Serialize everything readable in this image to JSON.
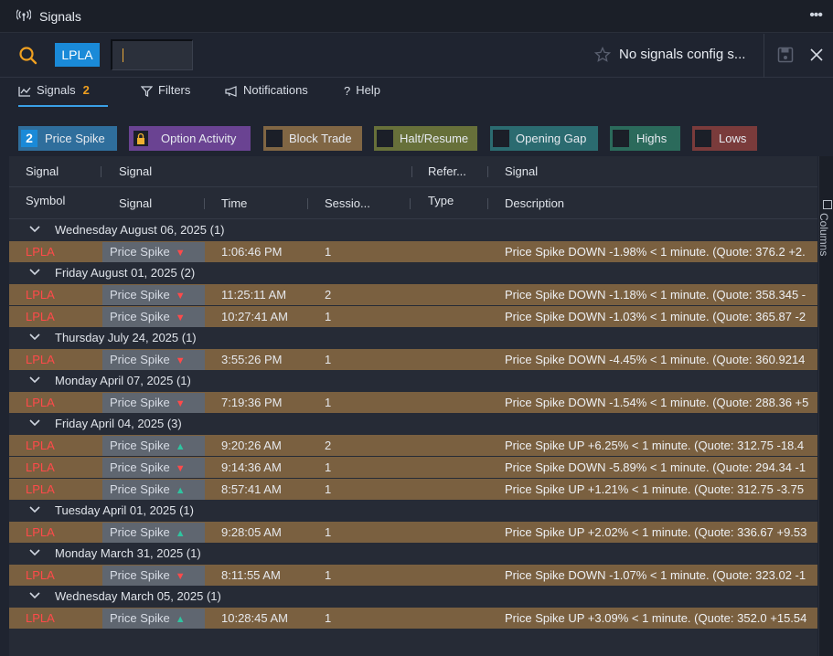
{
  "window": {
    "title": "Signals",
    "menu_icon": "ellipsis-icon"
  },
  "toolbar": {
    "symbol_tag": "LPLA",
    "symbol_input_value": "",
    "config_label": "No signals config s...",
    "icons": [
      "search-icon",
      "star-icon",
      "save-icon",
      "close-icon"
    ]
  },
  "tabs": [
    {
      "label": "Signals",
      "badge": "2",
      "icon": "chart-line-icon",
      "active": true
    },
    {
      "label": "Filters",
      "icon": "filter-icon"
    },
    {
      "label": "Notifications",
      "icon": "megaphone-icon"
    },
    {
      "label": "Help",
      "icon": "question-icon"
    }
  ],
  "chips": {
    "price_spike": {
      "label": "Price Spike",
      "count": "2"
    },
    "option_activity": {
      "label": "Option Activity"
    },
    "block_trade": {
      "label": "Block Trade"
    },
    "halt_resume": {
      "label": "Halt/Resume"
    },
    "opening_gap": {
      "label": "Opening Gap"
    },
    "highs": {
      "label": "Highs"
    },
    "lows": {
      "label": "Lows"
    }
  },
  "colors": {
    "accent_blue": "#1a8ad8",
    "row_bg": "#7a6040",
    "symbol_red": "#ff4a4a",
    "up_green": "#2fc4a0",
    "badge_orange": "#f0a020"
  },
  "grid": {
    "group_headers": {
      "signal": "Signal",
      "signal2": "Signal",
      "reference": "Refer...",
      "signal3": "Signal"
    },
    "columns": {
      "symbol": "Symbol",
      "signal": "Signal",
      "time": "Time",
      "session": "Sessio...",
      "type": "Type",
      "description": "Description"
    },
    "side_panel_label": "Columns",
    "groups": [
      {
        "label": "Wednesday August 06, 2025 (1)",
        "rows": [
          {
            "symbol": "LPLA",
            "signal": "Price Spike",
            "dir": "down",
            "time": "1:06:46 PM",
            "session": "1",
            "description": "Price Spike DOWN -1.98% < 1 minute. (Quote: 376.2 +2."
          }
        ]
      },
      {
        "label": "Friday August 01, 2025 (2)",
        "rows": [
          {
            "symbol": "LPLA",
            "signal": "Price Spike",
            "dir": "down",
            "time": "11:25:11 AM",
            "session": "2",
            "description": "Price Spike DOWN -1.18% < 1 minute. (Quote: 358.345 -"
          },
          {
            "symbol": "LPLA",
            "signal": "Price Spike",
            "dir": "down",
            "time": "10:27:41 AM",
            "session": "1",
            "description": "Price Spike DOWN -1.03% < 1 minute. (Quote: 365.87 -2"
          }
        ]
      },
      {
        "label": "Thursday July 24, 2025 (1)",
        "rows": [
          {
            "symbol": "LPLA",
            "signal": "Price Spike",
            "dir": "down",
            "time": "3:55:26 PM",
            "session": "1",
            "description": "Price Spike DOWN -4.45% < 1 minute. (Quote: 360.9214"
          }
        ]
      },
      {
        "label": "Monday April 07, 2025 (1)",
        "rows": [
          {
            "symbol": "LPLA",
            "signal": "Price Spike",
            "dir": "down",
            "time": "7:19:36 PM",
            "session": "1",
            "description": "Price Spike DOWN -1.54% < 1 minute. (Quote: 288.36 +5"
          }
        ]
      },
      {
        "label": "Friday April 04, 2025 (3)",
        "rows": [
          {
            "symbol": "LPLA",
            "signal": "Price Spike",
            "dir": "up",
            "time": "9:20:26 AM",
            "session": "2",
            "description": "Price Spike UP +6.25% < 1 minute. (Quote: 312.75 -18.4"
          },
          {
            "symbol": "LPLA",
            "signal": "Price Spike",
            "dir": "down",
            "time": "9:14:36 AM",
            "session": "1",
            "description": "Price Spike DOWN -5.89% < 1 minute. (Quote: 294.34 -1"
          },
          {
            "symbol": "LPLA",
            "signal": "Price Spike",
            "dir": "up",
            "time": "8:57:41 AM",
            "session": "1",
            "description": "Price Spike UP +1.21% < 1 minute. (Quote: 312.75 -3.75"
          }
        ]
      },
      {
        "label": "Tuesday April 01, 2025 (1)",
        "rows": [
          {
            "symbol": "LPLA",
            "signal": "Price Spike",
            "dir": "up",
            "time": "9:28:05 AM",
            "session": "1",
            "description": "Price Spike UP +2.02% < 1 minute. (Quote: 336.67 +9.53"
          }
        ]
      },
      {
        "label": "Monday March 31, 2025 (1)",
        "rows": [
          {
            "symbol": "LPLA",
            "signal": "Price Spike",
            "dir": "down",
            "time": "8:11:55 AM",
            "session": "1",
            "description": "Price Spike DOWN -1.07% < 1 minute. (Quote: 323.02 -1"
          }
        ]
      },
      {
        "label": "Wednesday March 05, 2025 (1)",
        "rows": [
          {
            "symbol": "LPLA",
            "signal": "Price Spike",
            "dir": "up",
            "time": "10:28:45 AM",
            "session": "1",
            "description": "Price Spike UP +3.09% < 1 minute. (Quote: 352.0 +15.54"
          }
        ]
      }
    ]
  }
}
